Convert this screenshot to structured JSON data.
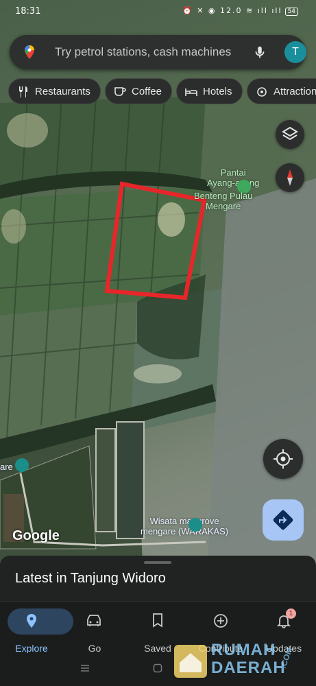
{
  "status_bar": {
    "time": "18:31",
    "icons_text": "⏰ ✕ ◉ 12.0 ≋ ıll ıll",
    "battery": "54"
  },
  "search": {
    "placeholder": "Try petrol stations, cash machines",
    "avatar_letter": "T"
  },
  "chips": [
    {
      "label": "Restaurants",
      "icon": "cutlery-icon"
    },
    {
      "label": "Coffee",
      "icon": "coffee-cup-icon"
    },
    {
      "label": "Hotels",
      "icon": "bed-icon"
    },
    {
      "label": "Attraction",
      "icon": "attraction-icon"
    }
  ],
  "map": {
    "labels": {
      "pantai": "Pantai\nAyang-ayang",
      "benteng": "Benteng Pulau\nMengare",
      "wisata": "Wisata mangrove\nmengare (WARAKAS)",
      "left_cut": "are"
    },
    "attribution": "Google",
    "highlight_color": "#e8262a"
  },
  "sheet": {
    "title": "Latest in Tanjung Widoro"
  },
  "nav": {
    "items": [
      {
        "label": "Explore",
        "icon": "location-pin-icon",
        "active": true
      },
      {
        "label": "Go",
        "icon": "car-icon",
        "active": false
      },
      {
        "label": "Saved",
        "icon": "bookmark-icon",
        "active": false
      },
      {
        "label": "Contribute",
        "icon": "add-circle-icon",
        "active": false
      },
      {
        "label": "Updates",
        "icon": "bell-icon",
        "active": false,
        "badge": "1"
      }
    ]
  },
  "watermark": {
    "line1": "RUMAH",
    "line2": "DAERAH",
    "suffix": ".COM"
  }
}
